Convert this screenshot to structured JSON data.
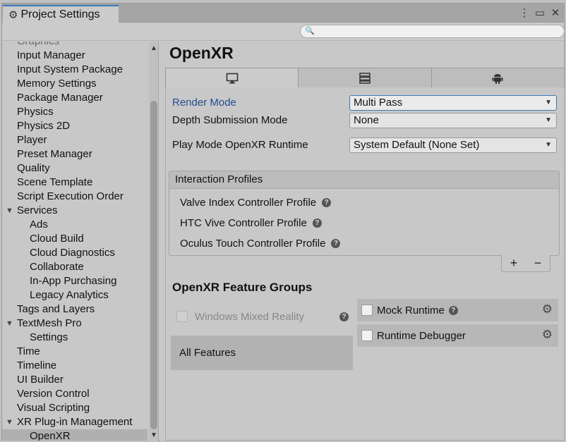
{
  "window": {
    "tab_title": "Project Settings",
    "icons": {
      "tab": "gear-icon",
      "more": "more-vert-icon",
      "maximize": "maximize-icon",
      "close": "close-icon"
    }
  },
  "search": {
    "placeholder": "",
    "value": ""
  },
  "sidebar": {
    "items": [
      {
        "label": "Graphics",
        "level": 0,
        "cut": true
      },
      {
        "label": "Input Manager",
        "level": 0
      },
      {
        "label": "Input System Package",
        "level": 0
      },
      {
        "label": "Memory Settings",
        "level": 0
      },
      {
        "label": "Package Manager",
        "level": 0
      },
      {
        "label": "Physics",
        "level": 0
      },
      {
        "label": "Physics 2D",
        "level": 0
      },
      {
        "label": "Player",
        "level": 0
      },
      {
        "label": "Preset Manager",
        "level": 0
      },
      {
        "label": "Quality",
        "level": 0
      },
      {
        "label": "Scene Template",
        "level": 0
      },
      {
        "label": "Script Execution Order",
        "level": 0
      },
      {
        "label": "Services",
        "level": 0,
        "expanded": true
      },
      {
        "label": "Ads",
        "level": 1
      },
      {
        "label": "Cloud Build",
        "level": 1
      },
      {
        "label": "Cloud Diagnostics",
        "level": 1
      },
      {
        "label": "Collaborate",
        "level": 1
      },
      {
        "label": "In-App Purchasing",
        "level": 1
      },
      {
        "label": "Legacy Analytics",
        "level": 1
      },
      {
        "label": "Tags and Layers",
        "level": 0
      },
      {
        "label": "TextMesh Pro",
        "level": 0,
        "expanded": true
      },
      {
        "label": "Settings",
        "level": 1
      },
      {
        "label": "Time",
        "level": 0
      },
      {
        "label": "Timeline",
        "level": 0
      },
      {
        "label": "UI Builder",
        "level": 0
      },
      {
        "label": "Version Control",
        "level": 0
      },
      {
        "label": "Visual Scripting",
        "level": 0
      },
      {
        "label": "XR Plug-in Management",
        "level": 0,
        "expanded": true
      },
      {
        "label": "OpenXR",
        "level": 1,
        "selected": true
      }
    ]
  },
  "main": {
    "title": "OpenXR",
    "platform_tabs": [
      {
        "icon": "monitor-icon",
        "glyph": "🖵",
        "active": true
      },
      {
        "icon": "server-icon",
        "glyph": "☰",
        "active": false
      },
      {
        "icon": "android-icon",
        "glyph": "🤖",
        "active": false
      }
    ],
    "render_mode": {
      "label": "Render Mode",
      "value": "Multi Pass"
    },
    "depth_submission": {
      "label": "Depth Submission Mode",
      "value": "None"
    },
    "play_mode_runtime": {
      "label": "Play Mode OpenXR Runtime",
      "value": "System Default (None Set)"
    },
    "interaction_profiles": {
      "header": "Interaction Profiles",
      "items": [
        "Valve Index Controller Profile",
        "HTC Vive Controller Profile",
        "Oculus Touch Controller Profile"
      ],
      "add_label": "+",
      "remove_label": "−"
    },
    "feature_groups": {
      "title": "OpenXR Feature Groups",
      "platform": {
        "label": "Windows Mixed Reality",
        "checked": false,
        "enabled": false
      },
      "all_features_label": "All Features",
      "features": [
        {
          "label": "Mock Runtime",
          "checked": false,
          "has_help": true
        },
        {
          "label": "Runtime Debugger",
          "checked": false,
          "has_help": false
        }
      ]
    }
  },
  "help_glyph": "?",
  "gear_glyph": "⚙",
  "colors": {
    "accent": "#3a79bb",
    "label_accent": "#1f4f8f"
  }
}
